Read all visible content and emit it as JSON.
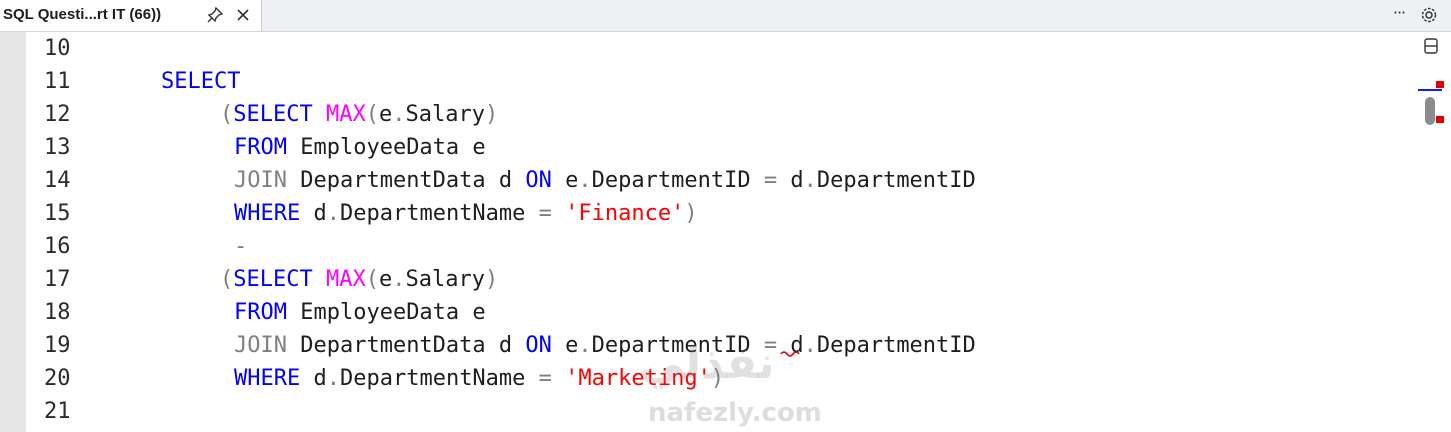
{
  "tab": {
    "title": "SQL Questi...rt IT (66))",
    "pin_icon": "pin-icon",
    "close_icon": "close-icon"
  },
  "strip": {
    "more_label": "···",
    "more_icon": "more-horizontal-icon",
    "settings_icon": "gear-icon"
  },
  "editor": {
    "lines": [
      {
        "n": "10",
        "tokens": []
      },
      {
        "n": "11",
        "tokens": [
          {
            "t": "SELECT",
            "c": "kw"
          }
        ]
      },
      {
        "n": "12",
        "tokens": [
          {
            "t": "(",
            "c": "gy"
          },
          {
            "t": "SELECT",
            "c": "kw"
          },
          {
            "t": " ",
            "c": ""
          },
          {
            "t": "MAX",
            "c": "fn"
          },
          {
            "t": "(",
            "c": "gy"
          },
          {
            "t": "e",
            "c": ""
          },
          {
            "t": ".",
            "c": "gy"
          },
          {
            "t": "Salary",
            "c": ""
          },
          {
            "t": ")",
            "c": "gy"
          }
        ]
      },
      {
        "n": "13",
        "tokens": [
          {
            "t": "FROM",
            "c": "kw"
          },
          {
            "t": " EmployeeData e",
            "c": ""
          }
        ]
      },
      {
        "n": "14",
        "tokens": [
          {
            "t": "JOIN",
            "c": "gy"
          },
          {
            "t": " DepartmentData d ",
            "c": ""
          },
          {
            "t": "ON",
            "c": "kw"
          },
          {
            "t": " e",
            "c": ""
          },
          {
            "t": ".",
            "c": "gy"
          },
          {
            "t": "DepartmentID ",
            "c": ""
          },
          {
            "t": "=",
            "c": "gy"
          },
          {
            "t": " d",
            "c": ""
          },
          {
            "t": ".",
            "c": "gy"
          },
          {
            "t": "DepartmentID",
            "c": ""
          }
        ]
      },
      {
        "n": "15",
        "tokens": [
          {
            "t": "WHERE",
            "c": "kw"
          },
          {
            "t": " d",
            "c": ""
          },
          {
            "t": ".",
            "c": "gy"
          },
          {
            "t": "DepartmentName ",
            "c": ""
          },
          {
            "t": "=",
            "c": "gy"
          },
          {
            "t": " ",
            "c": ""
          },
          {
            "t": "'Finance'",
            "c": "st"
          },
          {
            "t": ")",
            "c": "gy"
          }
        ]
      },
      {
        "n": "16",
        "tokens": [
          {
            "t": "-",
            "c": "gy"
          }
        ]
      },
      {
        "n": "17",
        "tokens": [
          {
            "t": "(",
            "c": "gy"
          },
          {
            "t": "SELECT",
            "c": "kw"
          },
          {
            "t": " ",
            "c": ""
          },
          {
            "t": "MAX",
            "c": "fn"
          },
          {
            "t": "(",
            "c": "gy"
          },
          {
            "t": "e",
            "c": ""
          },
          {
            "t": ".",
            "c": "gy"
          },
          {
            "t": "Salary",
            "c": ""
          },
          {
            "t": ")",
            "c": "gy"
          }
        ]
      },
      {
        "n": "18",
        "tokens": [
          {
            "t": "FROM",
            "c": "kw"
          },
          {
            "t": " EmployeeData e",
            "c": ""
          }
        ]
      },
      {
        "n": "19",
        "tokens": [
          {
            "t": "JOIN",
            "c": "gy"
          },
          {
            "t": " DepartmentData d ",
            "c": ""
          },
          {
            "t": "ON",
            "c": "kw"
          },
          {
            "t": " e",
            "c": ""
          },
          {
            "t": ".",
            "c": "gy"
          },
          {
            "t": "DepartmentID ",
            "c": ""
          },
          {
            "t": "=",
            "c": "gy"
          },
          {
            "t": " d",
            "c": ""
          },
          {
            "t": ".",
            "c": "gy"
          },
          {
            "t": "DepartmentID",
            "c": ""
          }
        ]
      },
      {
        "n": "20",
        "tokens": [
          {
            "t": "WHERE",
            "c": "kw"
          },
          {
            "t": " d",
            "c": ""
          },
          {
            "t": ".",
            "c": "gy"
          },
          {
            "t": "DepartmentName ",
            "c": ""
          },
          {
            "t": "=",
            "c": "gy"
          },
          {
            "t": " ",
            "c": ""
          },
          {
            "t": "'Marketing'",
            "c": "st"
          },
          {
            "t": ")",
            "c": "gy"
          }
        ]
      },
      {
        "n": "21",
        "tokens": []
      }
    ]
  },
  "scrollbar": {
    "split_icon": "split-editor-icon",
    "error_marker_color": "#e00000",
    "caret_marker_color": "#1a1aff"
  },
  "watermark": {
    "arabic": "نفذلي",
    "latin": "nafezly.com"
  },
  "colors": {
    "keyword": "#0000ff",
    "function": "#ff00ff",
    "operator": "#808080",
    "string": "#ff0000"
  }
}
